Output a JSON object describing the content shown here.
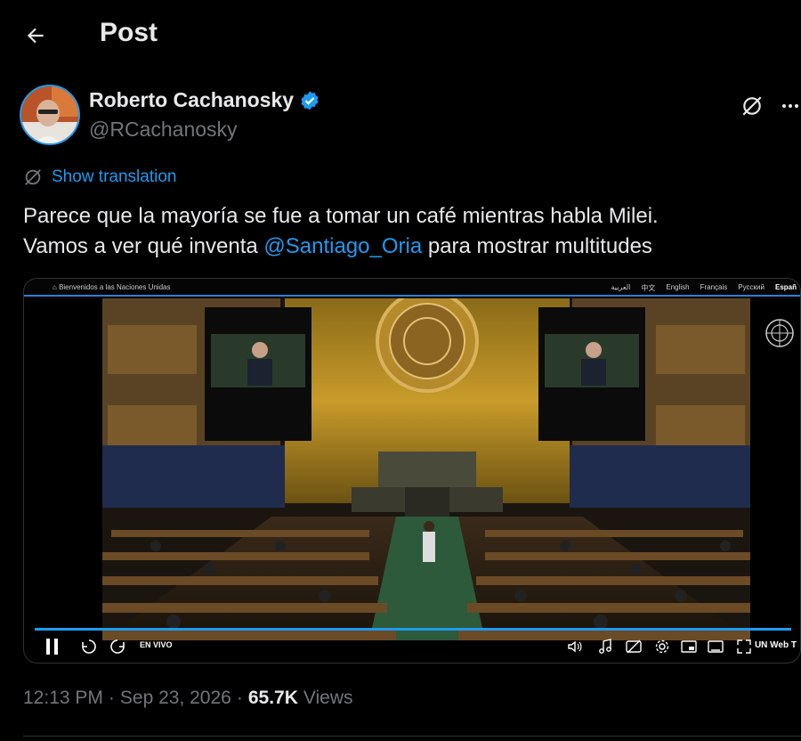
{
  "header": {
    "title": "Post",
    "back_icon": "arrow-left-icon"
  },
  "author": {
    "name": "Roberto Cachanosky",
    "handle": "@RCachanosky",
    "verified": true,
    "verified_color": "#1d9bf0"
  },
  "actions": {
    "grok_icon": "grok-icon",
    "more_icon": "more-horizontal-icon"
  },
  "translation": {
    "label": "Show translation",
    "icon": "globe-icon"
  },
  "tweet": {
    "line1": "Parece que la mayoría se fue a tomar un café mientras habla Milei.",
    "line2_before": "Vamos a ver qué inventa ",
    "mention": "@Santiago_Oria",
    "line2_after": " para mostrar multitudes"
  },
  "video": {
    "site_label": "Bienvenidos a las Naciones Unidas",
    "languages": [
      "العربية",
      "中文",
      "English",
      "Français",
      "Русский",
      "Españ"
    ],
    "live_label": "EN VIVO",
    "channel_label": "UN Web T",
    "progress_fraction": 1.0
  },
  "meta": {
    "time": "12:13 PM",
    "sep1": "·",
    "date": "Sep 23, 2026",
    "sep2": "·",
    "views_count": "65.7K",
    "views_label": "Views"
  },
  "colors": {
    "accent": "#1d9bf0",
    "text": "#e7e9ea",
    "muted": "#71767b",
    "background": "#000000"
  }
}
